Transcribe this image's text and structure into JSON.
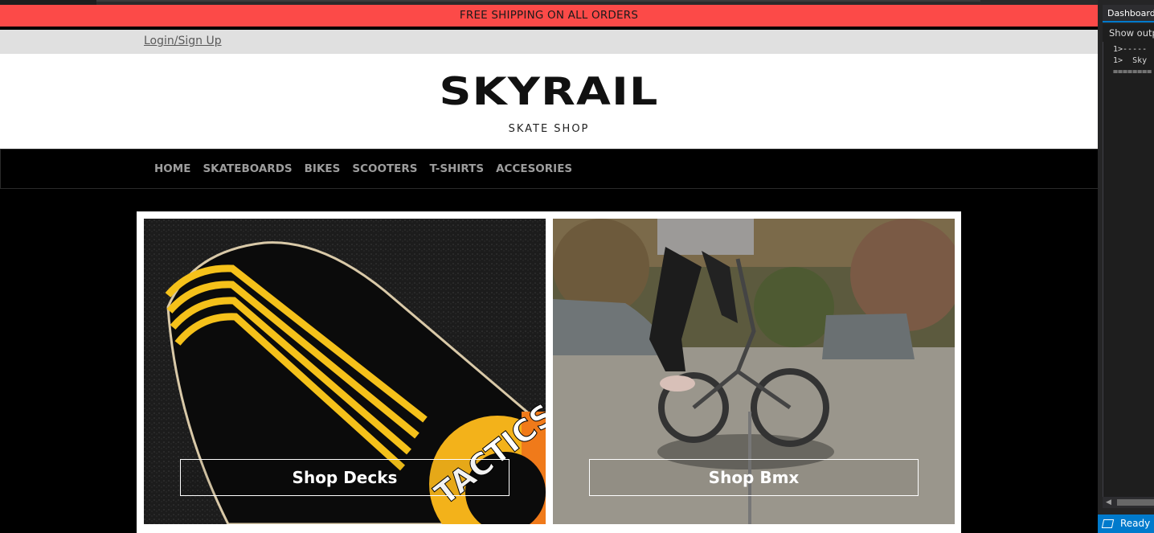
{
  "promo": {
    "text": "FREE SHIPPING ON ALL ORDERS"
  },
  "account": {
    "login_label": "Login/Sign Up"
  },
  "brand": {
    "logo_text": "SKYRAIL",
    "tagline": "SKATE SHOP"
  },
  "nav": {
    "items": [
      {
        "label": "HOME"
      },
      {
        "label": "SKATEBOARDS"
      },
      {
        "label": "BIKES"
      },
      {
        "label": "SCOOTERS"
      },
      {
        "label": "T-SHIRTS"
      },
      {
        "label": "ACCESORIES"
      }
    ]
  },
  "tiles": [
    {
      "cta": "Shop Decks",
      "deck_print_text": "TACTICS"
    },
    {
      "cta": "Shop Bmx"
    }
  ],
  "ide": {
    "panel_tab": "Dashboard",
    "output_label": "Show outp",
    "output_lines": [
      "1>-----",
      "1>  Sky",
      "========"
    ],
    "status": "Ready"
  },
  "colors": {
    "promo_bg": "#fc4a48",
    "login_bar_bg": "#e0e0e0",
    "nav_bg": "#000000",
    "nav_text": "#9d9d9d",
    "ide_accent": "#007acc"
  }
}
